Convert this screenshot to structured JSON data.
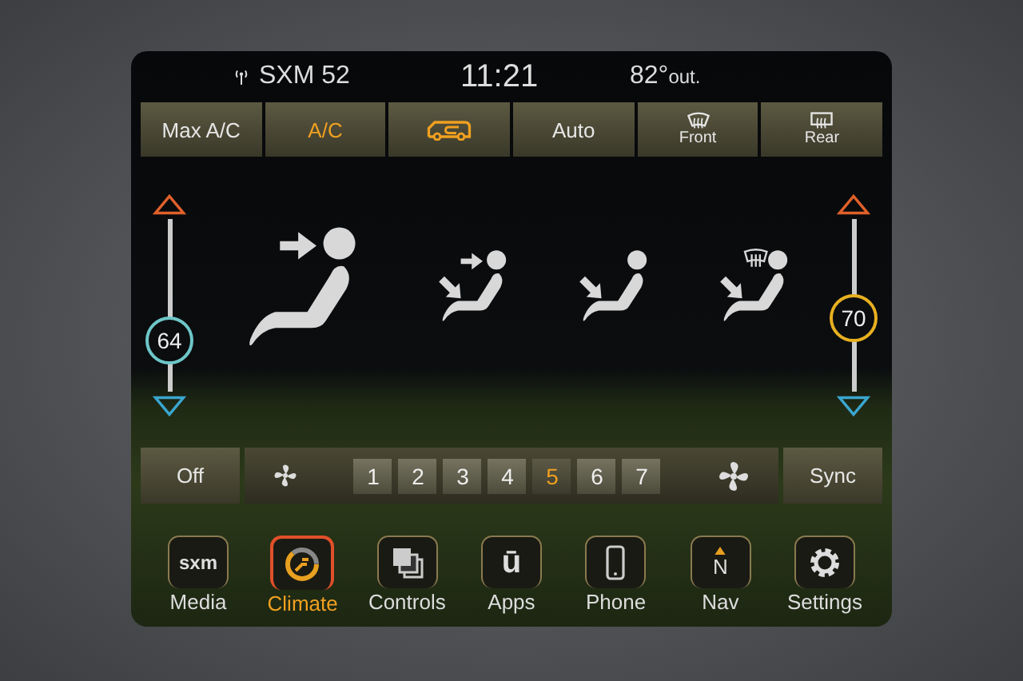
{
  "status_bar": {
    "station": "SXM 52",
    "time": "11:21",
    "outside_temp": "82°",
    "outside_suffix": "out."
  },
  "climate_buttons": [
    {
      "kind": "text",
      "label": "Max A/C",
      "on": false
    },
    {
      "kind": "text",
      "label": "A/C",
      "on": true
    },
    {
      "kind": "recirculation",
      "on": true
    },
    {
      "kind": "text",
      "label": "Auto",
      "on": false
    },
    {
      "kind": "front-defrost",
      "label": "Front",
      "on": false
    },
    {
      "kind": "rear-defrost",
      "label": "Rear",
      "on": false
    }
  ],
  "temperatures": [
    {
      "kind": "left",
      "reading": "64",
      "level": 0.3,
      "color": "#6ec6c8"
    },
    {
      "kind": "right",
      "reading": "70",
      "level": 0.43,
      "color": "#e8b020"
    }
  ],
  "airflow_modes": [
    {
      "kind": "face",
      "selected": true
    },
    {
      "kind": "bilevel",
      "selected": false
    },
    {
      "kind": "feet",
      "selected": false
    },
    {
      "kind": "defrost-feet",
      "selected": false
    }
  ],
  "fan": {
    "off_label": "Off",
    "speeds": [
      {
        "label": "1",
        "selected": false
      },
      {
        "label": "2",
        "selected": false
      },
      {
        "label": "3",
        "selected": false
      },
      {
        "label": "4",
        "selected": false
      },
      {
        "label": "5",
        "selected": true
      },
      {
        "label": "6",
        "selected": false
      },
      {
        "label": "7",
        "selected": false
      }
    ],
    "sync_label": "Sync"
  },
  "nav_bar": [
    {
      "kind": "sxm",
      "icon_text": "sxm",
      "label": "Media",
      "selected": false
    },
    {
      "kind": "climate",
      "label": "Climate",
      "selected": true
    },
    {
      "kind": "controls",
      "label": "Controls",
      "selected": false
    },
    {
      "kind": "apps",
      "icon_text": "ū",
      "label": "Apps",
      "selected": false
    },
    {
      "kind": "phone",
      "label": "Phone",
      "selected": false
    },
    {
      "kind": "nav",
      "icon_text": "N",
      "label": "Nav",
      "selected": false
    },
    {
      "kind": "settings",
      "label": "Settings",
      "selected": false
    }
  ]
}
